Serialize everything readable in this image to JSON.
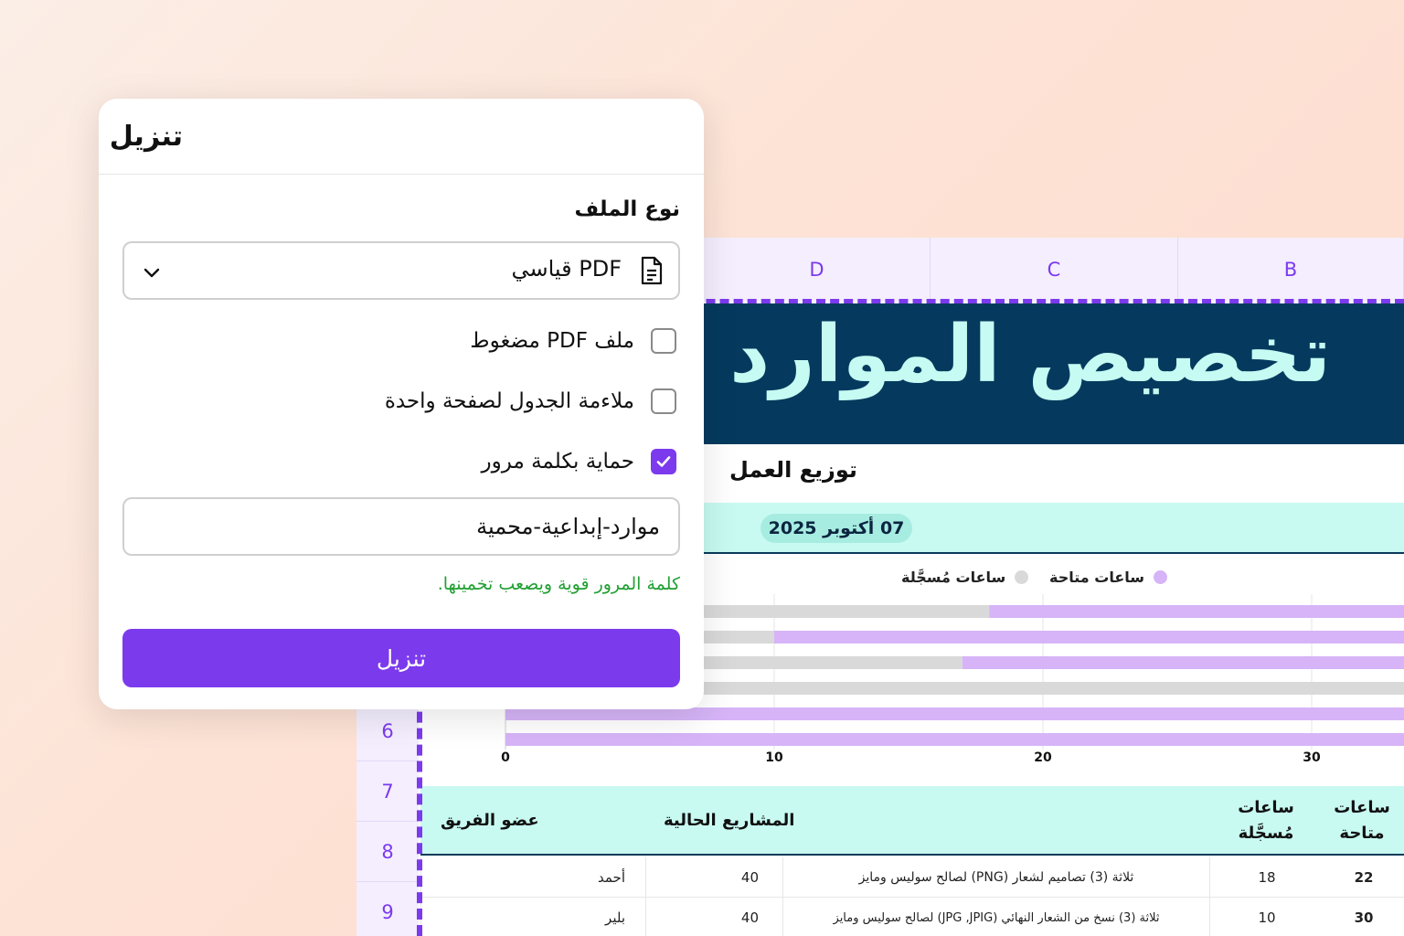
{
  "spreadsheet": {
    "columns": [
      "D",
      "C",
      "B"
    ],
    "rows": [
      "6",
      "7",
      "8",
      "9"
    ],
    "banner_title": "تخصيص الموارد",
    "section_title": "توزيع العمل",
    "date": "07 أكتوبر 2025",
    "legend": {
      "available": "ساعات متاحة",
      "logged": "ساعات مُسجَّلة"
    },
    "colors": {
      "available": "#d6b4f7",
      "logged": "#d9d9d9",
      "banner_bg": "#053a5e",
      "banner_text": "#c6fbf3",
      "accent": "#7c3aed",
      "band": "#c8faf2"
    },
    "table": {
      "headers": {
        "team_member": "عضو الفريق",
        "current_projects": "المشاريع الحالية",
        "logged_line1": "ساعات",
        "logged_line2": "مُسجَّلة",
        "available_line1": "ساعات",
        "available_line2": "متاحة"
      },
      "rows": [
        {
          "member": "أحمد",
          "hours": "40",
          "project": "ثلاثة (3) تصاميم لشعار (PNG) لصالح سوليس ومايز",
          "logged": "18",
          "available": "22"
        },
        {
          "member": "بلير",
          "hours": "40",
          "project": "ثلاثة (3) نسخ من الشعار النهائي (JPG ,JPIG) لصالح سوليس ومايز",
          "logged": "10",
          "available": "30"
        }
      ]
    }
  },
  "chart_data": {
    "type": "bar",
    "orientation": "horizontal",
    "stacked": true,
    "x_ticks": [
      "0",
      "10",
      "20",
      "30"
    ],
    "xlim": [
      0,
      33
    ],
    "series": [
      {
        "name": "ساعات مُسجَّلة",
        "values": [
          18,
          10,
          17,
          40,
          0,
          0
        ]
      },
      {
        "name": "ساعات متاحة",
        "values": [
          22,
          30,
          23,
          0,
          40,
          40
        ]
      }
    ],
    "grid": true,
    "legend_position": "top"
  },
  "dialog": {
    "title": "تنزيل",
    "file_type_label": "نوع الملف",
    "file_type_value": "PDF قياسي",
    "options": [
      {
        "label": "ملف PDF مضغوط",
        "checked": false
      },
      {
        "label": "ملاءمة الجدول لصفحة واحدة",
        "checked": false
      },
      {
        "label": "حماية بكلمة مرور",
        "checked": true
      }
    ],
    "password_value": "موارد-إبداعية-محمية",
    "password_hint": "كلمة المرور قوية ويصعب تخمينها.",
    "button_label": "تنزيل"
  }
}
